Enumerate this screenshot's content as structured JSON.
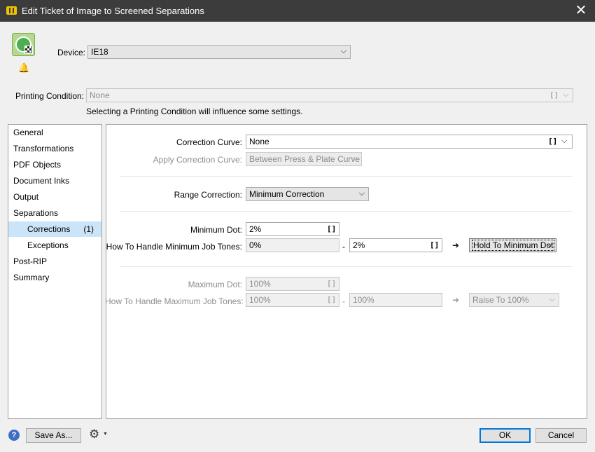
{
  "window": {
    "title": "Edit Ticket of Image to Screened Separations"
  },
  "device": {
    "label": "Device:",
    "value": "IE18"
  },
  "printing_condition": {
    "label": "Printing Condition:",
    "value": "None",
    "note": "Selecting a Printing Condition will influence some settings."
  },
  "nav": {
    "items": [
      {
        "label": "General"
      },
      {
        "label": "Transformations"
      },
      {
        "label": "PDF Objects"
      },
      {
        "label": "Document Inks"
      },
      {
        "label": "Output"
      },
      {
        "label": "Separations"
      },
      {
        "label": "Corrections",
        "count": "(1)"
      },
      {
        "label": "Exceptions"
      },
      {
        "label": "Post-RIP"
      },
      {
        "label": "Summary"
      }
    ]
  },
  "corrections": {
    "correction_curve": {
      "label": "Correction Curve:",
      "value": "None"
    },
    "apply_correction_curve": {
      "label": "Apply Correction Curve:",
      "value": "Between Press & Plate Curve"
    },
    "range_correction": {
      "label": "Range Correction:",
      "value": "Minimum Correction"
    },
    "minimum_dot": {
      "label": "Minimum Dot:",
      "value": "2%"
    },
    "min_job_tones": {
      "label": "How To Handle Minimum Job Tones:",
      "from": "0%",
      "dash": "-",
      "to": "2%",
      "action": "Hold To Minimum Dot"
    },
    "maximum_dot": {
      "label": "Maximum Dot:",
      "value": "100%"
    },
    "max_job_tones": {
      "label": "How To Handle Maximum Job Tones:",
      "from": "100%",
      "dash": "-",
      "to": "100%",
      "action": "Raise To 100%"
    }
  },
  "footer": {
    "save_as": "Save As...",
    "ok": "OK",
    "cancel": "Cancel"
  },
  "glyphs": {
    "bracket": "[]",
    "chevron": "⌵",
    "arrow": "➜",
    "close": "✕",
    "bell": "🔔",
    "gear": "⚙",
    "caret": "▼",
    "help": "?"
  },
  "colors": {
    "titlebar": "#3c3c3c",
    "selection": "#cce4f7",
    "accent": "#0078d7"
  },
  "icons": [
    "ticket-icon",
    "device-icon",
    "bell-icon",
    "close-icon",
    "help-icon",
    "gear-icon",
    "arrow-right-icon",
    "chevron-down-icon",
    "bracket-icon"
  ]
}
